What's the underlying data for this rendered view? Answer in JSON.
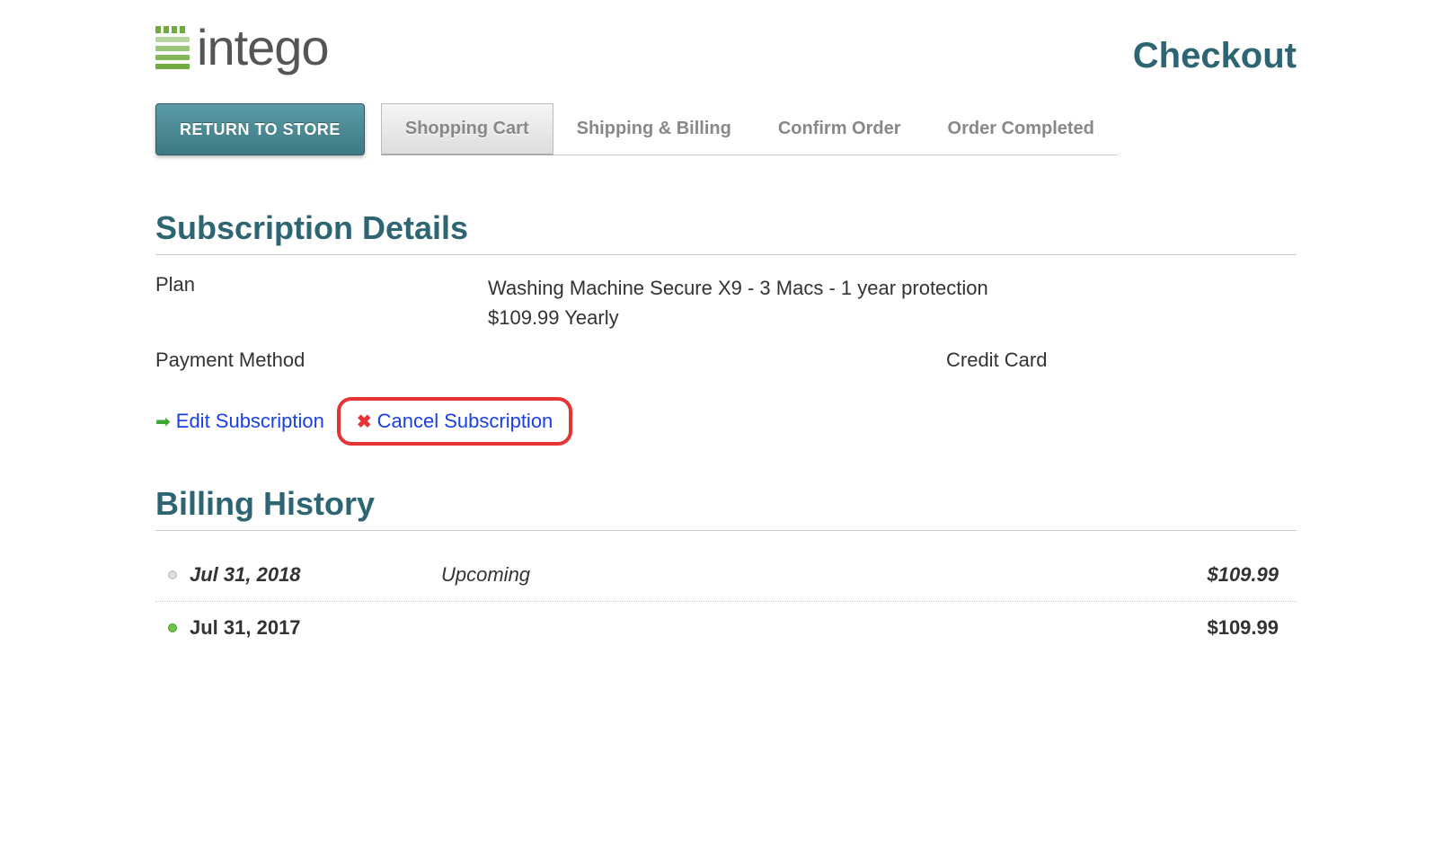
{
  "header": {
    "logo_text": "intego",
    "checkout_title": "Checkout"
  },
  "nav": {
    "return_label": "RETURN TO STORE",
    "tabs": [
      {
        "label": "Shopping Cart",
        "active": true
      },
      {
        "label": "Shipping & Billing",
        "active": false
      },
      {
        "label": "Confirm Order",
        "active": false
      },
      {
        "label": "Order Completed",
        "active": false
      }
    ]
  },
  "subscription": {
    "title": "Subscription Details",
    "plan_label": "Plan",
    "plan_name": "Washing Machine Secure X9 - 3 Macs - 1 year protection",
    "plan_price": "$109.99 Yearly",
    "payment_label": "Payment Method",
    "payment_value": "Credit Card",
    "edit_label": "Edit Subscription",
    "cancel_label": "Cancel Subscription"
  },
  "billing": {
    "title": "Billing History",
    "rows": [
      {
        "date": "Jul 31, 2018",
        "status": "Upcoming",
        "amount": "$109.99",
        "upcoming": true
      },
      {
        "date": "Jul 31, 2017",
        "status": "",
        "amount": "$109.99",
        "upcoming": false
      }
    ]
  }
}
